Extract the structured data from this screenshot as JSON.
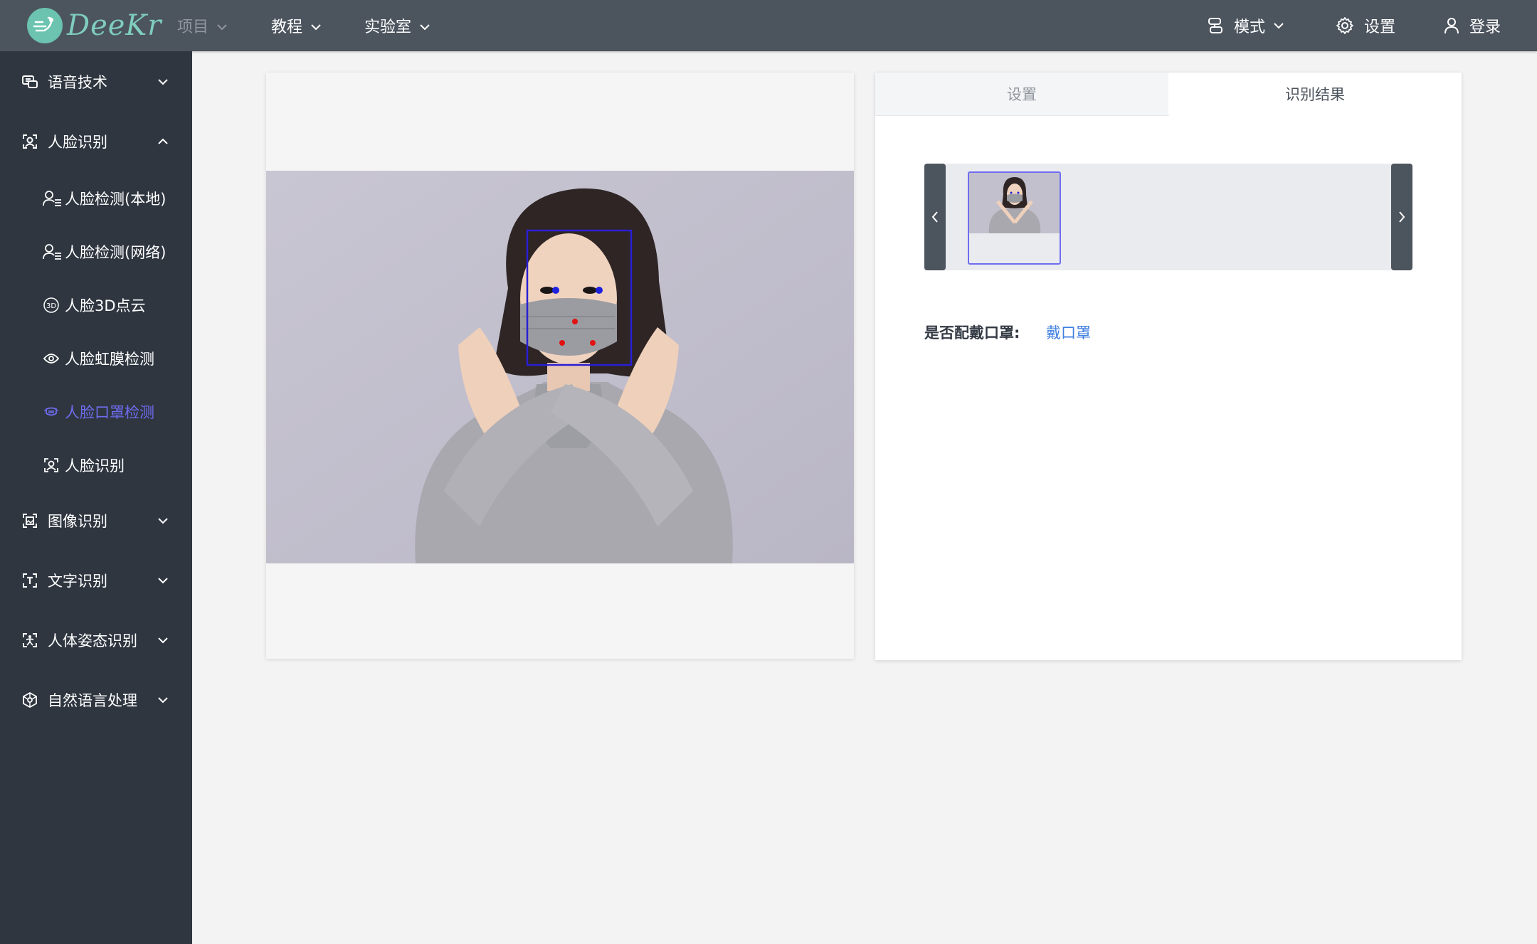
{
  "app": {
    "logo_text": "DeeKr"
  },
  "topnav": {
    "items": [
      {
        "label": "项目",
        "disabled": true
      },
      {
        "label": "教程"
      },
      {
        "label": "实验室"
      }
    ],
    "right": {
      "mode_label": "模式",
      "settings_label": "设置",
      "login_label": "登录"
    }
  },
  "sidebar": {
    "groups": [
      {
        "label": "语音技术",
        "icon": "speech-icon",
        "expanded": false
      },
      {
        "label": "人脸识别",
        "icon": "face-icon",
        "expanded": true
      },
      {
        "label": "图像识别",
        "icon": "image-scan-icon",
        "expanded": false
      },
      {
        "label": "文字识别",
        "icon": "text-scan-icon",
        "expanded": false
      },
      {
        "label": "人体姿态识别",
        "icon": "body-pose-icon",
        "expanded": false
      },
      {
        "label": "自然语言处理",
        "icon": "nlp-icon",
        "expanded": false
      }
    ],
    "face_items": [
      {
        "label": "人脸检测(本地)",
        "icon": "user-list-icon"
      },
      {
        "label": "人脸检测(网络)",
        "icon": "user-list-icon"
      },
      {
        "label": "人脸3D点云",
        "icon": "3d-icon"
      },
      {
        "label": "人脸虹膜检测",
        "icon": "eye-icon"
      },
      {
        "label": "人脸口罩检测",
        "icon": "mask-icon",
        "active": true
      },
      {
        "label": "人脸识别",
        "icon": "face-icon"
      }
    ]
  },
  "tabs": {
    "settings": "设置",
    "result": "识别结果",
    "active": "result"
  },
  "result": {
    "mask_label": "是否配戴口罩:",
    "mask_value": "戴口罩"
  },
  "colors": {
    "topbar": "#4c545e",
    "sidebar": "#2f3640",
    "accent": "#6f6cf0",
    "link": "#3f7fe0",
    "detection_box": "#2a1fd6"
  }
}
